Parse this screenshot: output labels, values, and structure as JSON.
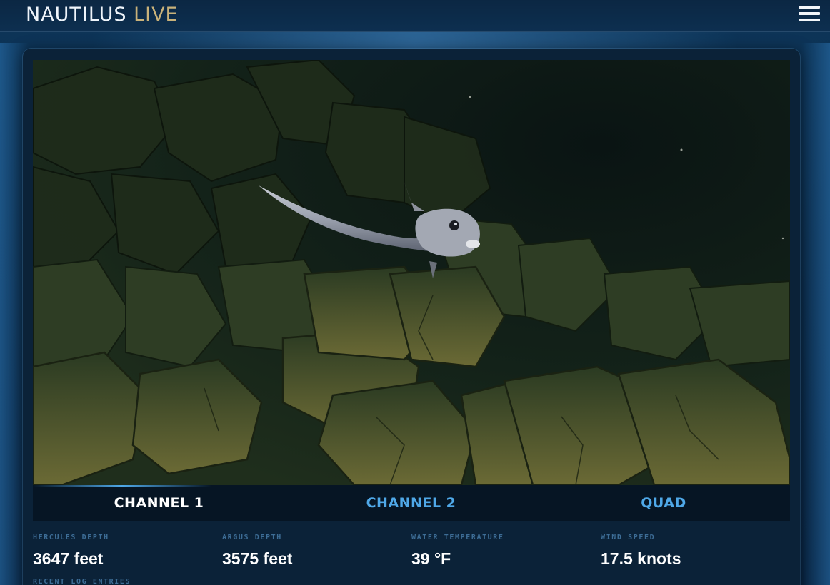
{
  "header": {
    "logo_main": "NAUTILUS",
    "logo_accent": "LIVE",
    "menu_icon": "hamburger-menu-icon"
  },
  "video": {
    "scene": "deep-sea-fish-over-rocks"
  },
  "tabs": [
    {
      "label": "CHANNEL 1",
      "active": true
    },
    {
      "label": "CHANNEL 2",
      "active": false
    },
    {
      "label": "QUAD",
      "active": false
    }
  ],
  "stats": [
    {
      "label": "HERCULES DEPTH",
      "value": "3647 feet"
    },
    {
      "label": "ARGUS DEPTH",
      "value": "3575 feet"
    },
    {
      "label": "WATER TEMPERATURE",
      "value": "39 °F"
    },
    {
      "label": "WIND SPEED",
      "value": "17.5 knots"
    }
  ],
  "log": {
    "label": "RECENT LOG ENTRIES"
  },
  "colors": {
    "accent_blue": "#4fa8e8",
    "logo_gold": "#c9b27a",
    "background": "#0b2c4b"
  }
}
